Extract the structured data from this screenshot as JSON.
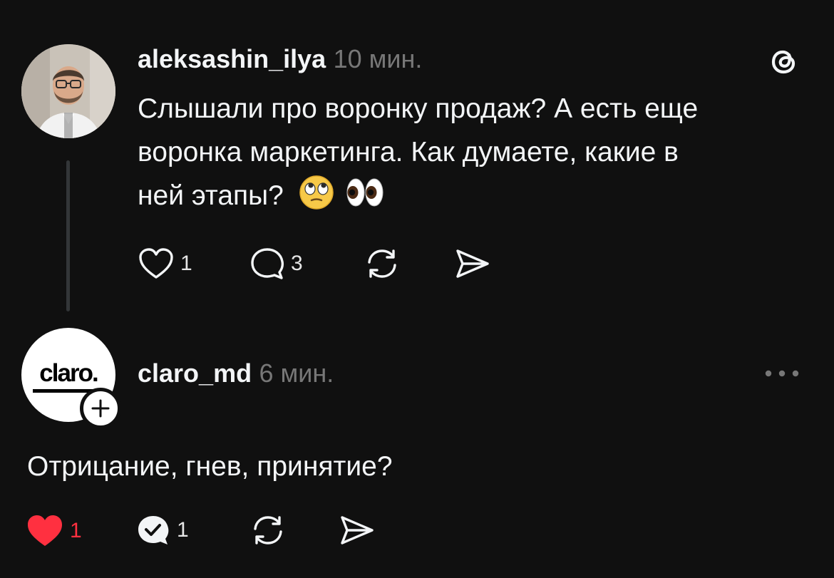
{
  "post": {
    "username": "aleksashin_ilya",
    "time": "10 мин.",
    "text": "Слышали про воронку продаж? А есть еще воронка маркетинга. Как думаете, какие в ней этапы?",
    "text_lines": [
      "Слышали про воронку продаж? А есть еще",
      "воронка маркетинга. Как думаете, какие в",
      "ней этапы?"
    ],
    "emojis": [
      "face-with-rolling-eyes",
      "eyes"
    ],
    "likes": "1",
    "replies": "3",
    "app_icon": "threads-logo-icon"
  },
  "reply": {
    "username": "claro_md",
    "time": "6 мин.",
    "avatar_text": "claro.",
    "text": "Отрицание, гнев, принятие?",
    "likes": "1",
    "replies": "1",
    "liked": true,
    "like_color": "#ff3040"
  }
}
